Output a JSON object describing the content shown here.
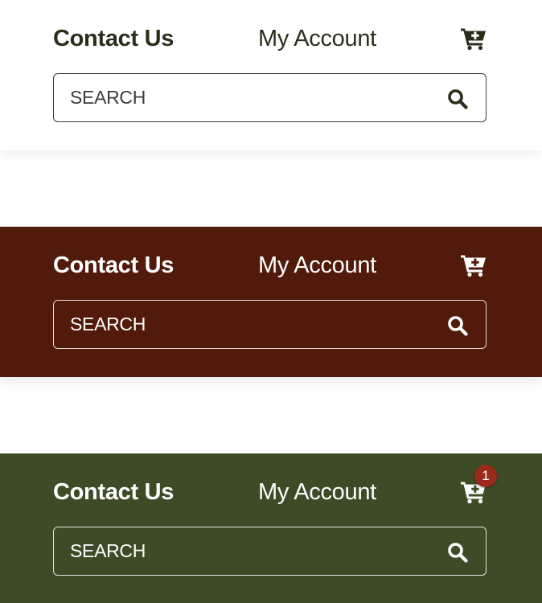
{
  "colors": {
    "light_bg": "#ffffff",
    "light_text": "#2a2f1b",
    "red_bg": "#511a0b",
    "green_bg": "#3d4b27",
    "badge_bg": "#9a2a1a"
  },
  "header_light": {
    "contact_label": "Contact Us",
    "account_label": "My Account",
    "cart_icon": "cart-plus-icon",
    "search_placeholder": "SEARCH",
    "search_icon": "search-icon"
  },
  "header_red": {
    "contact_label": "Contact Us",
    "account_label": "My Account",
    "cart_icon": "cart-plus-icon",
    "search_placeholder": "SEARCH",
    "search_icon": "search-icon"
  },
  "header_green": {
    "contact_label": "Contact Us",
    "account_label": "My Account",
    "cart_icon": "cart-plus-icon",
    "cart_badge": "1",
    "search_placeholder": "SEARCH",
    "search_icon": "search-icon"
  }
}
